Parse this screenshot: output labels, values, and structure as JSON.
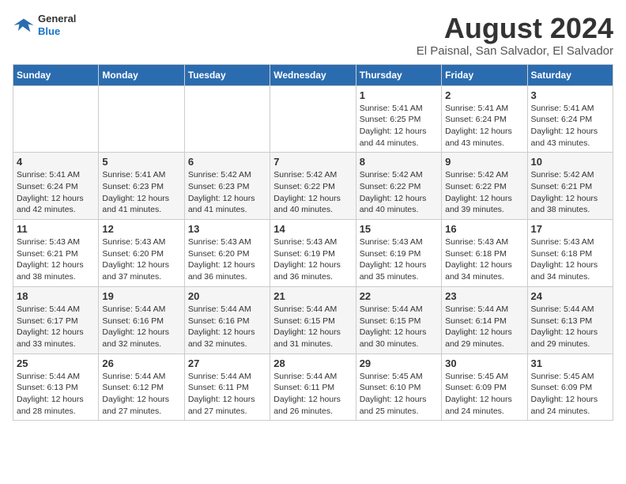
{
  "header": {
    "logo_general": "General",
    "logo_blue": "Blue",
    "month_year": "August 2024",
    "location": "El Paisnal, San Salvador, El Salvador"
  },
  "calendar": {
    "days_of_week": [
      "Sunday",
      "Monday",
      "Tuesday",
      "Wednesday",
      "Thursday",
      "Friday",
      "Saturday"
    ],
    "weeks": [
      [
        {
          "day": "",
          "info": ""
        },
        {
          "day": "",
          "info": ""
        },
        {
          "day": "",
          "info": ""
        },
        {
          "day": "",
          "info": ""
        },
        {
          "day": "1",
          "info": "Sunrise: 5:41 AM\nSunset: 6:25 PM\nDaylight: 12 hours\nand 44 minutes."
        },
        {
          "day": "2",
          "info": "Sunrise: 5:41 AM\nSunset: 6:24 PM\nDaylight: 12 hours\nand 43 minutes."
        },
        {
          "day": "3",
          "info": "Sunrise: 5:41 AM\nSunset: 6:24 PM\nDaylight: 12 hours\nand 43 minutes."
        }
      ],
      [
        {
          "day": "4",
          "info": "Sunrise: 5:41 AM\nSunset: 6:24 PM\nDaylight: 12 hours\nand 42 minutes."
        },
        {
          "day": "5",
          "info": "Sunrise: 5:41 AM\nSunset: 6:23 PM\nDaylight: 12 hours\nand 41 minutes."
        },
        {
          "day": "6",
          "info": "Sunrise: 5:42 AM\nSunset: 6:23 PM\nDaylight: 12 hours\nand 41 minutes."
        },
        {
          "day": "7",
          "info": "Sunrise: 5:42 AM\nSunset: 6:22 PM\nDaylight: 12 hours\nand 40 minutes."
        },
        {
          "day": "8",
          "info": "Sunrise: 5:42 AM\nSunset: 6:22 PM\nDaylight: 12 hours\nand 40 minutes."
        },
        {
          "day": "9",
          "info": "Sunrise: 5:42 AM\nSunset: 6:22 PM\nDaylight: 12 hours\nand 39 minutes."
        },
        {
          "day": "10",
          "info": "Sunrise: 5:42 AM\nSunset: 6:21 PM\nDaylight: 12 hours\nand 38 minutes."
        }
      ],
      [
        {
          "day": "11",
          "info": "Sunrise: 5:43 AM\nSunset: 6:21 PM\nDaylight: 12 hours\nand 38 minutes."
        },
        {
          "day": "12",
          "info": "Sunrise: 5:43 AM\nSunset: 6:20 PM\nDaylight: 12 hours\nand 37 minutes."
        },
        {
          "day": "13",
          "info": "Sunrise: 5:43 AM\nSunset: 6:20 PM\nDaylight: 12 hours\nand 36 minutes."
        },
        {
          "day": "14",
          "info": "Sunrise: 5:43 AM\nSunset: 6:19 PM\nDaylight: 12 hours\nand 36 minutes."
        },
        {
          "day": "15",
          "info": "Sunrise: 5:43 AM\nSunset: 6:19 PM\nDaylight: 12 hours\nand 35 minutes."
        },
        {
          "day": "16",
          "info": "Sunrise: 5:43 AM\nSunset: 6:18 PM\nDaylight: 12 hours\nand 34 minutes."
        },
        {
          "day": "17",
          "info": "Sunrise: 5:43 AM\nSunset: 6:18 PM\nDaylight: 12 hours\nand 34 minutes."
        }
      ],
      [
        {
          "day": "18",
          "info": "Sunrise: 5:44 AM\nSunset: 6:17 PM\nDaylight: 12 hours\nand 33 minutes."
        },
        {
          "day": "19",
          "info": "Sunrise: 5:44 AM\nSunset: 6:16 PM\nDaylight: 12 hours\nand 32 minutes."
        },
        {
          "day": "20",
          "info": "Sunrise: 5:44 AM\nSunset: 6:16 PM\nDaylight: 12 hours\nand 32 minutes."
        },
        {
          "day": "21",
          "info": "Sunrise: 5:44 AM\nSunset: 6:15 PM\nDaylight: 12 hours\nand 31 minutes."
        },
        {
          "day": "22",
          "info": "Sunrise: 5:44 AM\nSunset: 6:15 PM\nDaylight: 12 hours\nand 30 minutes."
        },
        {
          "day": "23",
          "info": "Sunrise: 5:44 AM\nSunset: 6:14 PM\nDaylight: 12 hours\nand 29 minutes."
        },
        {
          "day": "24",
          "info": "Sunrise: 5:44 AM\nSunset: 6:13 PM\nDaylight: 12 hours\nand 29 minutes."
        }
      ],
      [
        {
          "day": "25",
          "info": "Sunrise: 5:44 AM\nSunset: 6:13 PM\nDaylight: 12 hours\nand 28 minutes."
        },
        {
          "day": "26",
          "info": "Sunrise: 5:44 AM\nSunset: 6:12 PM\nDaylight: 12 hours\nand 27 minutes."
        },
        {
          "day": "27",
          "info": "Sunrise: 5:44 AM\nSunset: 6:11 PM\nDaylight: 12 hours\nand 27 minutes."
        },
        {
          "day": "28",
          "info": "Sunrise: 5:44 AM\nSunset: 6:11 PM\nDaylight: 12 hours\nand 26 minutes."
        },
        {
          "day": "29",
          "info": "Sunrise: 5:45 AM\nSunset: 6:10 PM\nDaylight: 12 hours\nand 25 minutes."
        },
        {
          "day": "30",
          "info": "Sunrise: 5:45 AM\nSunset: 6:09 PM\nDaylight: 12 hours\nand 24 minutes."
        },
        {
          "day": "31",
          "info": "Sunrise: 5:45 AM\nSunset: 6:09 PM\nDaylight: 12 hours\nand 24 minutes."
        }
      ]
    ]
  }
}
